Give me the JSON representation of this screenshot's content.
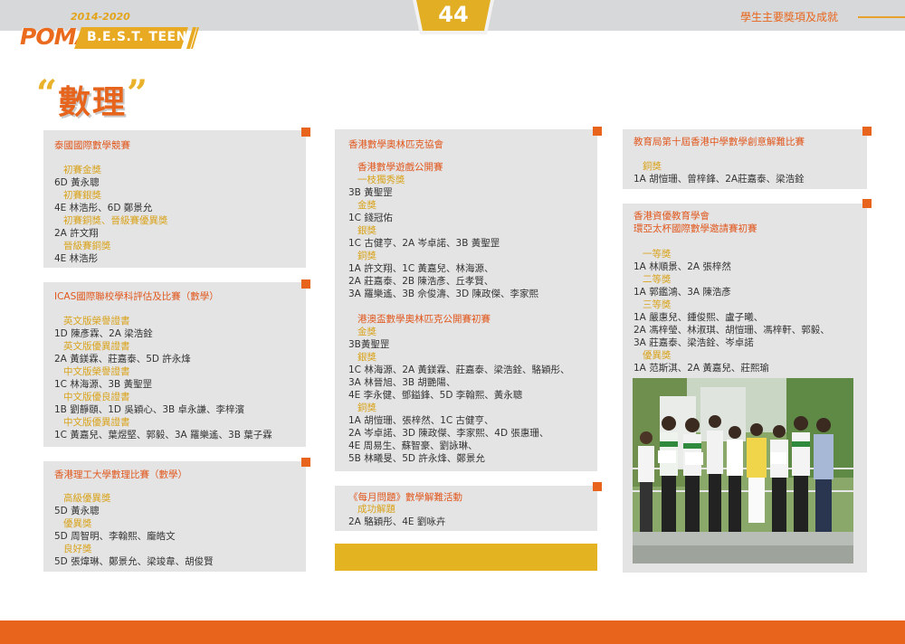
{
  "header": {
    "brand_years": "2014-2020",
    "brand_poma": "POMA",
    "brand_best": "B.E.S.T. TEEN",
    "page_number": "44",
    "section_title": "學生主要獎項及成就"
  },
  "page_title": "數理",
  "col1": {
    "panel1": {
      "title": "泰國國際數學競賽",
      "lines": [
        {
          "t": "初賽金獎",
          "k": "g"
        },
        {
          "t": "6D 黃永聰",
          "k": "b"
        },
        {
          "t": "初賽銀獎",
          "k": "g"
        },
        {
          "t": "4E 林浩彤、6D 鄭景允",
          "k": "b"
        },
        {
          "t": "初賽銅獎、晉級賽優異獎",
          "k": "g"
        },
        {
          "t": "2A 許文翔",
          "k": "b"
        },
        {
          "t": "晉級賽銅獎",
          "k": "g"
        },
        {
          "t": "4E 林浩彤",
          "k": "b"
        }
      ]
    },
    "panel2": {
      "title": "ICAS國際聯校學科評估及比賽（數學）",
      "lines": [
        {
          "t": "英文版榮譽證書",
          "k": "g"
        },
        {
          "t": "1D 陳彥霖、2A 梁浩銓",
          "k": "b"
        },
        {
          "t": "英文版優異證書",
          "k": "g"
        },
        {
          "t": "2A 黃鎂霖、莊嘉泰、5D 許永烽",
          "k": "b"
        },
        {
          "t": "中文版榮譽證書",
          "k": "g"
        },
        {
          "t": "1C 林海源、3B 黃聖罡",
          "k": "b"
        },
        {
          "t": "中文版優良證書",
          "k": "g"
        },
        {
          "t": "1B 劉靜頤、1D 吳穎心、3B 卓永謙、李梓濱",
          "k": "b"
        },
        {
          "t": "中文版優異證書",
          "k": "g"
        },
        {
          "t": "1C 黃嘉兒、葉煜堅、郭毅、3A 羅樂遙、3B 葉子霖",
          "k": "b"
        }
      ]
    },
    "panel3": {
      "title": "香港理工大學數理比賽（數學）",
      "lines": [
        {
          "t": "高級優異獎",
          "k": "g"
        },
        {
          "t": "5D 黃永聰",
          "k": "b"
        },
        {
          "t": "優異獎",
          "k": "g"
        },
        {
          "t": "5D 周智明、李翰熙、龐皓文",
          "k": "b"
        },
        {
          "t": "良好獎",
          "k": "g"
        },
        {
          "t": "5D 張煒琳、鄭景允、梁竣韋、胡俊賢",
          "k": "b"
        }
      ]
    }
  },
  "col2": {
    "panel1": {
      "title": "香港數學奧林匹克協會",
      "lines": [
        {
          "t": "香港數學遊戲公開賽",
          "k": "o"
        },
        {
          "t": "一枝獨秀獎",
          "k": "g"
        },
        {
          "t": "3B 黃聖罡",
          "k": "b"
        },
        {
          "t": "金獎",
          "k": "g"
        },
        {
          "t": "1C 錢冠佑",
          "k": "b"
        },
        {
          "t": "銀獎",
          "k": "g"
        },
        {
          "t": "1C 古健亨、2A 岑卓諾、3B 黃聖罡",
          "k": "b"
        },
        {
          "t": "銅獎",
          "k": "g"
        },
        {
          "t": "1A 許文翔、1C 黃嘉兒、林海源、",
          "k": "b"
        },
        {
          "t": "2A 莊嘉泰、2B 陳浩彥、丘孝賢、",
          "k": "b"
        },
        {
          "t": "3A 羅樂遙、3B 佘俊濤、3D 陳政傑、李家熙",
          "k": "b"
        },
        {
          "t": "",
          "k": "b"
        },
        {
          "t": "港澳盃數學奧林匹克公開賽初賽",
          "k": "o"
        },
        {
          "t": "金獎",
          "k": "g"
        },
        {
          "t": "3B黃聖罡",
          "k": "b"
        },
        {
          "t": "銀獎",
          "k": "g"
        },
        {
          "t": "1C 林海源、2A 黃鎂霖、莊嘉泰、梁浩銓、駱穎彤、",
          "k": "b"
        },
        {
          "t": "3A 林晉旭、3B 胡艷陽、",
          "k": "b"
        },
        {
          "t": "4E 李永健、鄧鎰鋒、5D 李翰熙、黃永聰",
          "k": "b"
        },
        {
          "t": "銅獎",
          "k": "g"
        },
        {
          "t": "1A 胡愷珊、張梓然、1C 古健亨、",
          "k": "b"
        },
        {
          "t": "2A 岑卓諾、3D 陳政傑、李家熙、4D 張惠珊、",
          "k": "b"
        },
        {
          "t": "4E 周易生、蘇智豪、劉詠琳、",
          "k": "b"
        },
        {
          "t": "5B 林曦旻、5D 許永烽、鄭景允",
          "k": "b"
        }
      ]
    },
    "panel2": {
      "title": "《每月問題》數學解難活動",
      "lines": [
        {
          "t": "成功解題",
          "k": "g"
        },
        {
          "t": "2A 駱穎彤、4E 劉咏卉",
          "k": "b"
        }
      ]
    }
  },
  "col3": {
    "panel1": {
      "title": "教育局第十屆香港中學數學創意解難比賽",
      "lines": [
        {
          "t": "銅獎",
          "k": "g"
        },
        {
          "t": "1A 胡愷珊、曾梓鋒、2A莊嘉泰、梁浩銓",
          "k": "b"
        }
      ]
    },
    "panel2": {
      "title_line1": "香港資優教育學會",
      "title_line2": "環亞太杯國際數學邀請賽初賽",
      "lines": [
        {
          "t": "一等獎",
          "k": "g"
        },
        {
          "t": "1A 林順景、2A 張梓然",
          "k": "b"
        },
        {
          "t": "二等獎",
          "k": "g"
        },
        {
          "t": "1A 郭鑑鴻、3A 陳浩彥",
          "k": "b"
        },
        {
          "t": "三等獎",
          "k": "g"
        },
        {
          "t": "1A 嚴惠兒、鍾俊熙、盧子曦、",
          "k": "b"
        },
        {
          "t": "2A 馮梓瑩、林淑琪、胡愷珊、馮梓軒、郭毅、",
          "k": "b"
        },
        {
          "t": "3A 莊嘉泰、梁浩銓、岑卓諾",
          "k": "b"
        },
        {
          "t": "優異獎",
          "k": "g"
        },
        {
          "t": "1A 范斯淇、2A 黃嘉兒、莊熙瑜",
          "k": "b"
        }
      ]
    }
  },
  "colors": {
    "orange": "#e8631b",
    "gold": "#d9a31b",
    "panel": "#e4e4e5"
  }
}
